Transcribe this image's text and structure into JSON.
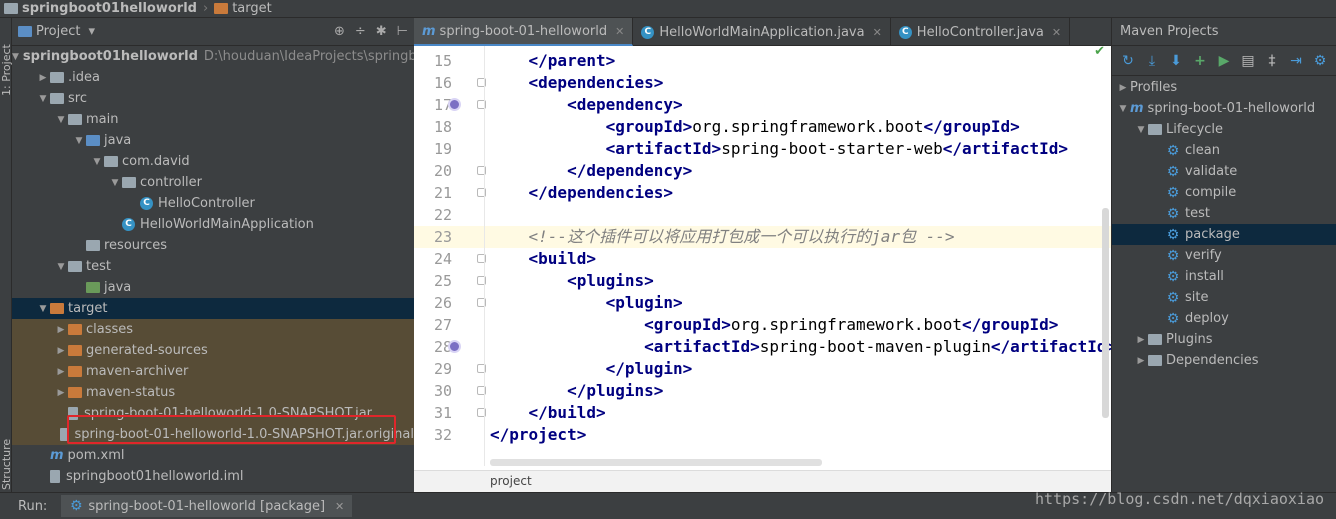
{
  "breadcrumb": {
    "project": "springboot01helloworld",
    "folder": "target"
  },
  "left_strip": {
    "project_tab": "1: Project",
    "structure_tab": "Structure"
  },
  "project_panel": {
    "title": "Project",
    "view_toggle": "▾",
    "tools": [
      "⊕",
      "÷",
      "✱",
      "⊢"
    ],
    "tree": [
      {
        "label": "springboot01helloworld",
        "path": "D:\\houduan\\IdeaProjects\\springboot",
        "depth": 0,
        "arrow": "▼",
        "icon": "folder-gray",
        "bold": true
      },
      {
        "label": ".idea",
        "depth": 1,
        "arrow": "▶",
        "icon": "folder-gray"
      },
      {
        "label": "src",
        "depth": 1,
        "arrow": "▼",
        "icon": "folder-gray"
      },
      {
        "label": "main",
        "depth": 2,
        "arrow": "▼",
        "icon": "folder-gray"
      },
      {
        "label": "java",
        "depth": 3,
        "arrow": "▼",
        "icon": "folder-blue"
      },
      {
        "label": "com.david",
        "depth": 4,
        "arrow": "▼",
        "icon": "folder-gray"
      },
      {
        "label": "controller",
        "depth": 5,
        "arrow": "▼",
        "icon": "folder-gray"
      },
      {
        "label": "HelloController",
        "depth": 6,
        "arrow": "",
        "icon": "class"
      },
      {
        "label": "HelloWorldMainApplication",
        "depth": 5,
        "arrow": "",
        "icon": "class"
      },
      {
        "label": "resources",
        "depth": 3,
        "arrow": "",
        "icon": "folder-gray"
      },
      {
        "label": "test",
        "depth": 2,
        "arrow": "▼",
        "icon": "folder-gray"
      },
      {
        "label": "java",
        "depth": 3,
        "arrow": "",
        "icon": "folder-green"
      },
      {
        "label": "target",
        "depth": 1,
        "arrow": "▼",
        "icon": "folder-orange",
        "selected": true
      },
      {
        "label": "classes",
        "depth": 2,
        "arrow": "▶",
        "icon": "folder-orange",
        "excluded": true
      },
      {
        "label": "generated-sources",
        "depth": 2,
        "arrow": "▶",
        "icon": "folder-orange",
        "excluded": true
      },
      {
        "label": "maven-archiver",
        "depth": 2,
        "arrow": "▶",
        "icon": "folder-orange",
        "excluded": true
      },
      {
        "label": "maven-status",
        "depth": 2,
        "arrow": "▶",
        "icon": "folder-orange",
        "excluded": true
      },
      {
        "label": "spring-boot-01-helloworld-1.0-SNAPSHOT.jar",
        "depth": 2,
        "arrow": "",
        "icon": "file",
        "excluded": true
      },
      {
        "label": "spring-boot-01-helloworld-1.0-SNAPSHOT.jar.original",
        "depth": 2,
        "arrow": "",
        "icon": "file",
        "excluded": true
      },
      {
        "label": "pom.xml",
        "depth": 1,
        "arrow": "",
        "icon": "maven"
      },
      {
        "label": "springboot01helloworld.iml",
        "depth": 1,
        "arrow": "",
        "icon": "file"
      }
    ]
  },
  "editor": {
    "tabs": [
      {
        "label": "spring-boot-01-helloworld",
        "icon": "m",
        "active": true
      },
      {
        "label": "HelloWorldMainApplication.java",
        "icon": "c",
        "active": false
      },
      {
        "label": "HelloController.java",
        "icon": "c",
        "active": false
      }
    ],
    "lines": [
      {
        "n": "15",
        "segments": [
          [
            "",
            "    "
          ],
          [
            "tag",
            "</parent>"
          ]
        ]
      },
      {
        "n": "16",
        "segments": [
          [
            "",
            "    "
          ],
          [
            "tag",
            "<dependencies>"
          ]
        ]
      },
      {
        "n": "17",
        "segments": [
          [
            "",
            "        "
          ],
          [
            "tag",
            "<dependency>"
          ]
        ],
        "marker": true
      },
      {
        "n": "18",
        "segments": [
          [
            "",
            "            "
          ],
          [
            "tag",
            "<groupId>"
          ],
          [
            "",
            "org.springframework.boot"
          ],
          [
            "tag",
            "</groupId>"
          ]
        ]
      },
      {
        "n": "19",
        "segments": [
          [
            "",
            "            "
          ],
          [
            "tag",
            "<artifactId>"
          ],
          [
            "",
            "spring-boot-starter-web"
          ],
          [
            "tag",
            "</artifactId>"
          ]
        ]
      },
      {
        "n": "20",
        "segments": [
          [
            "",
            "        "
          ],
          [
            "tag",
            "</dependency>"
          ]
        ]
      },
      {
        "n": "21",
        "segments": [
          [
            "",
            "    "
          ],
          [
            "tag",
            "</dependencies>"
          ]
        ]
      },
      {
        "n": "22",
        "segments": []
      },
      {
        "n": "23",
        "segments": [
          [
            "",
            "    "
          ],
          [
            "cmt",
            "<!--这个插件可以将应用打包成一个可以执行的jar包 -->"
          ]
        ],
        "highlight": true
      },
      {
        "n": "24",
        "segments": [
          [
            "",
            "    "
          ],
          [
            "tag",
            "<build>"
          ]
        ]
      },
      {
        "n": "25",
        "segments": [
          [
            "",
            "        "
          ],
          [
            "tag",
            "<plugins>"
          ]
        ]
      },
      {
        "n": "26",
        "segments": [
          [
            "",
            "            "
          ],
          [
            "tag",
            "<plugin>"
          ]
        ]
      },
      {
        "n": "27",
        "segments": [
          [
            "",
            "                "
          ],
          [
            "tag",
            "<groupId>"
          ],
          [
            "",
            "org.springframework.boot"
          ],
          [
            "tag",
            "</groupId>"
          ]
        ]
      },
      {
        "n": "28",
        "segments": [
          [
            "",
            "                "
          ],
          [
            "tag",
            "<artifactId>"
          ],
          [
            "",
            "spring-boot-maven-plugin"
          ],
          [
            "tag",
            "</artifactId>"
          ]
        ],
        "marker": true
      },
      {
        "n": "29",
        "segments": [
          [
            "",
            "            "
          ],
          [
            "tag",
            "</plugin>"
          ]
        ]
      },
      {
        "n": "30",
        "segments": [
          [
            "",
            "        "
          ],
          [
            "tag",
            "</plugins>"
          ]
        ]
      },
      {
        "n": "31",
        "segments": [
          [
            "",
            "    "
          ],
          [
            "tag",
            "</build>"
          ]
        ]
      },
      {
        "n": "32",
        "segments": [
          [
            "tag",
            "</project>"
          ]
        ]
      }
    ],
    "breadcrumb_bottom": "project"
  },
  "maven_panel": {
    "title": "Maven Projects",
    "tools": [
      "↻",
      "⤓",
      "⬇",
      "+",
      "▶",
      "▤",
      "‡",
      "⇥",
      "⚙"
    ],
    "tree": [
      {
        "label": "Profiles",
        "depth": 0,
        "arrow": "▶",
        "icon": "none"
      },
      {
        "label": "spring-boot-01-helloworld",
        "depth": 0,
        "arrow": "▼",
        "icon": "maven"
      },
      {
        "label": "Lifecycle",
        "depth": 1,
        "arrow": "▼",
        "icon": "folder"
      },
      {
        "label": "clean",
        "depth": 2,
        "icon": "gear"
      },
      {
        "label": "validate",
        "depth": 2,
        "icon": "gear"
      },
      {
        "label": "compile",
        "depth": 2,
        "icon": "gear"
      },
      {
        "label": "test",
        "depth": 2,
        "icon": "gear"
      },
      {
        "label": "package",
        "depth": 2,
        "icon": "gear",
        "selected": true
      },
      {
        "label": "verify",
        "depth": 2,
        "icon": "gear"
      },
      {
        "label": "install",
        "depth": 2,
        "icon": "gear"
      },
      {
        "label": "site",
        "depth": 2,
        "icon": "gear"
      },
      {
        "label": "deploy",
        "depth": 2,
        "icon": "gear"
      },
      {
        "label": "Plugins",
        "depth": 1,
        "arrow": "▶",
        "icon": "folder"
      },
      {
        "label": "Dependencies",
        "depth": 1,
        "arrow": "▶",
        "icon": "folder"
      }
    ]
  },
  "runbar": {
    "label": "Run:",
    "tab": "spring-boot-01-helloworld [package]"
  },
  "watermark": "https://blog.csdn.net/dqxiaoxiao",
  "colors": {
    "accent": "#4a88c7",
    "selection": "#0d293e",
    "excluded": "#574c36",
    "highlight_box": "#e0262b"
  }
}
